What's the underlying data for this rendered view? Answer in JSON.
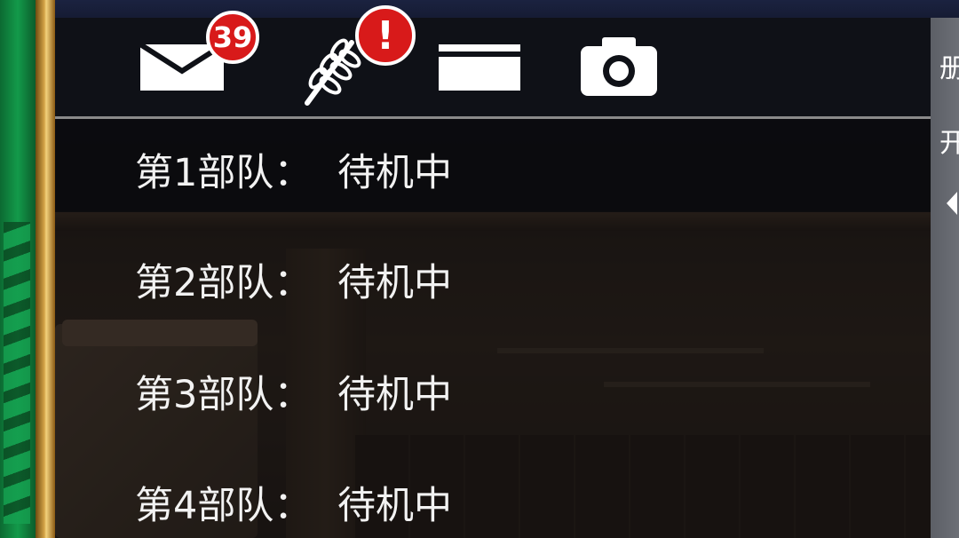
{
  "toolbar": {
    "mail_badge": "39",
    "alert_badge": "!"
  },
  "units": [
    {
      "label": "第1部队：",
      "status": "待机中"
    },
    {
      "label": "第2部队：",
      "status": "待机中"
    },
    {
      "label": "第3部队：",
      "status": "待机中"
    },
    {
      "label": "第4部队：",
      "status": "待机中"
    }
  ],
  "right_panel": {
    "glyph_1": "册",
    "glyph_2": "开"
  },
  "icons": [
    "mail-icon",
    "wheat-icon",
    "card-icon",
    "camera-icon"
  ],
  "colors": {
    "badge": "#d81a1a",
    "text": "#f2f2f2",
    "frame_green": "#139a4a",
    "frame_gold": "#d4a447"
  }
}
